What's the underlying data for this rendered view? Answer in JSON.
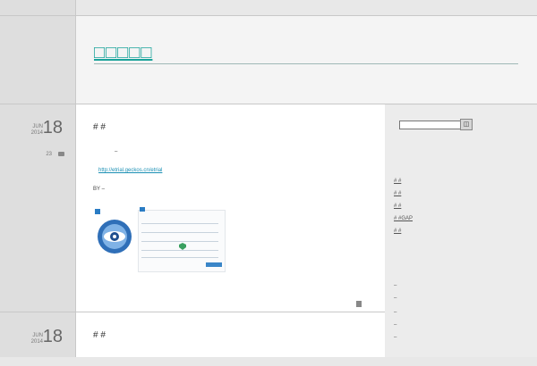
{
  "header": {
    "site_title": "□□□□□"
  },
  "posts": [
    {
      "month": "JUN",
      "year": "2014",
      "day": "18",
      "comment_count": "23",
      "title": "# #",
      "body_line1": "–",
      "link": "http://etrial.geckos.cn/etrial",
      "body_line2": "BY –"
    },
    {
      "month": "JUN",
      "year": "2014",
      "day": "18",
      "title": "# #"
    }
  ],
  "sidebar": {
    "search_placeholder": "",
    "search_button": "◫",
    "links": [
      "# #",
      "# #",
      "# #",
      "# #GAP",
      "# #"
    ],
    "dashes": [
      "–",
      "–",
      "–",
      "–",
      "–"
    ]
  },
  "colors": {
    "accent": "#1aa39a",
    "link": "#1a8fb4"
  }
}
